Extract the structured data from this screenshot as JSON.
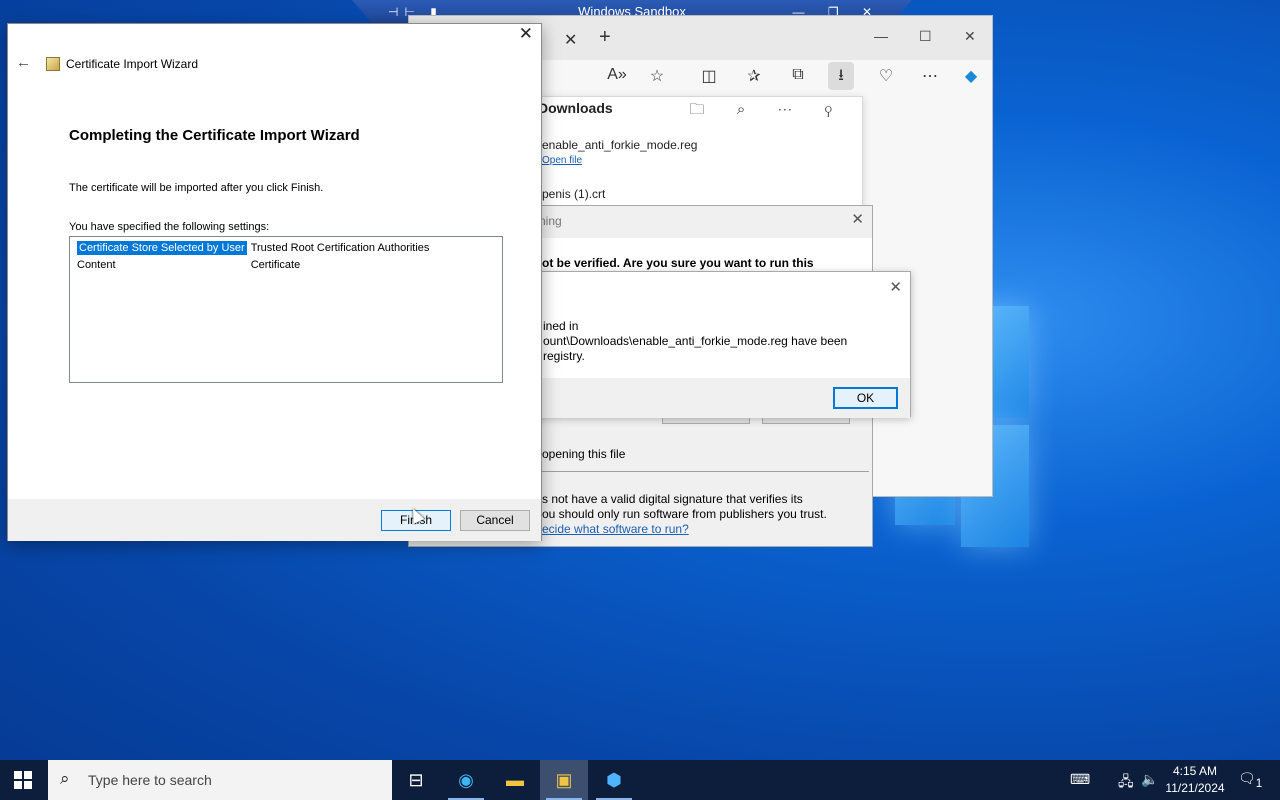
{
  "sandbox": {
    "title": "Windows Sandbox"
  },
  "browser": {
    "downloads": {
      "title": "Downloads",
      "file1": "enable_anti_forkie_mode.reg",
      "file1_action": "Open file",
      "file2": "penis (1).crt"
    }
  },
  "warning_dialog": {
    "title": "ning",
    "question": "ot be verified.  Are you sure you want to run this",
    "caution": "opening this file",
    "body_line1": "s not have a valid digital signature that verifies its",
    "body_line2": "ou should only run software from publishers you trust.",
    "link": "ecide what software to run?"
  },
  "registry_dialog": {
    "message_line1": "ined in",
    "message_line2": "ount\\Downloads\\enable_anti_forkie_mode.reg have been",
    "message_line3": "registry.",
    "ok_label": "OK"
  },
  "wizard": {
    "window_title": "Certificate Import Wizard",
    "heading": "Completing the Certificate Import Wizard",
    "description": "The certificate will be imported after you click Finish.",
    "settings_label": "You have specified the following settings:",
    "settings": [
      {
        "key": "Certificate Store Selected by User",
        "value": "Trusted Root Certification Authorities"
      },
      {
        "key": "Content",
        "value": "Certificate"
      }
    ],
    "finish_label": "Finish",
    "cancel_label": "Cancel"
  },
  "taskbar": {
    "search_placeholder": "Type here to search",
    "time": "4:15 AM",
    "date": "11/21/2024",
    "notification_count": "1"
  },
  "colors": {
    "selection": "#0078d7",
    "taskbar": "#0c1e3c",
    "link": "#1a5fb4"
  }
}
